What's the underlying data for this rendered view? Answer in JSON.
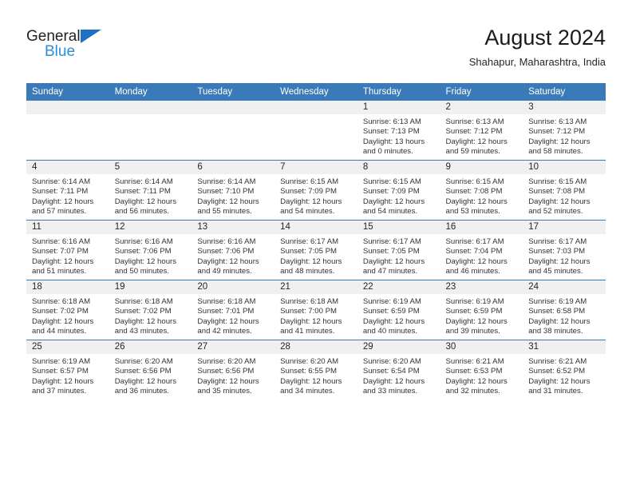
{
  "brand": {
    "name_line1": "General",
    "name_line2": "Blue",
    "logo_icon": "triangle-logo",
    "color_dark": "#231f20",
    "color_blue": "#2a8fd6"
  },
  "header": {
    "title": "August 2024",
    "location": "Shahapur, Maharashtra, India"
  },
  "calendar": {
    "accent_color": "#3b7ab8",
    "daynum_band_color": "#f0f0f0",
    "weekday_headers": [
      "Sunday",
      "Monday",
      "Tuesday",
      "Wednesday",
      "Thursday",
      "Friday",
      "Saturday"
    ],
    "weeks": [
      [
        {
          "day": "",
          "empty": true
        },
        {
          "day": "",
          "empty": true
        },
        {
          "day": "",
          "empty": true
        },
        {
          "day": "",
          "empty": true
        },
        {
          "day": "1",
          "sunrise": "Sunrise: 6:13 AM",
          "sunset": "Sunset: 7:13 PM",
          "daylight": "Daylight: 13 hours and 0 minutes."
        },
        {
          "day": "2",
          "sunrise": "Sunrise: 6:13 AM",
          "sunset": "Sunset: 7:12 PM",
          "daylight": "Daylight: 12 hours and 59 minutes."
        },
        {
          "day": "3",
          "sunrise": "Sunrise: 6:13 AM",
          "sunset": "Sunset: 7:12 PM",
          "daylight": "Daylight: 12 hours and 58 minutes."
        }
      ],
      [
        {
          "day": "4",
          "sunrise": "Sunrise: 6:14 AM",
          "sunset": "Sunset: 7:11 PM",
          "daylight": "Daylight: 12 hours and 57 minutes."
        },
        {
          "day": "5",
          "sunrise": "Sunrise: 6:14 AM",
          "sunset": "Sunset: 7:11 PM",
          "daylight": "Daylight: 12 hours and 56 minutes."
        },
        {
          "day": "6",
          "sunrise": "Sunrise: 6:14 AM",
          "sunset": "Sunset: 7:10 PM",
          "daylight": "Daylight: 12 hours and 55 minutes."
        },
        {
          "day": "7",
          "sunrise": "Sunrise: 6:15 AM",
          "sunset": "Sunset: 7:09 PM",
          "daylight": "Daylight: 12 hours and 54 minutes."
        },
        {
          "day": "8",
          "sunrise": "Sunrise: 6:15 AM",
          "sunset": "Sunset: 7:09 PM",
          "daylight": "Daylight: 12 hours and 54 minutes."
        },
        {
          "day": "9",
          "sunrise": "Sunrise: 6:15 AM",
          "sunset": "Sunset: 7:08 PM",
          "daylight": "Daylight: 12 hours and 53 minutes."
        },
        {
          "day": "10",
          "sunrise": "Sunrise: 6:15 AM",
          "sunset": "Sunset: 7:08 PM",
          "daylight": "Daylight: 12 hours and 52 minutes."
        }
      ],
      [
        {
          "day": "11",
          "sunrise": "Sunrise: 6:16 AM",
          "sunset": "Sunset: 7:07 PM",
          "daylight": "Daylight: 12 hours and 51 minutes."
        },
        {
          "day": "12",
          "sunrise": "Sunrise: 6:16 AM",
          "sunset": "Sunset: 7:06 PM",
          "daylight": "Daylight: 12 hours and 50 minutes."
        },
        {
          "day": "13",
          "sunrise": "Sunrise: 6:16 AM",
          "sunset": "Sunset: 7:06 PM",
          "daylight": "Daylight: 12 hours and 49 minutes."
        },
        {
          "day": "14",
          "sunrise": "Sunrise: 6:17 AM",
          "sunset": "Sunset: 7:05 PM",
          "daylight": "Daylight: 12 hours and 48 minutes."
        },
        {
          "day": "15",
          "sunrise": "Sunrise: 6:17 AM",
          "sunset": "Sunset: 7:05 PM",
          "daylight": "Daylight: 12 hours and 47 minutes."
        },
        {
          "day": "16",
          "sunrise": "Sunrise: 6:17 AM",
          "sunset": "Sunset: 7:04 PM",
          "daylight": "Daylight: 12 hours and 46 minutes."
        },
        {
          "day": "17",
          "sunrise": "Sunrise: 6:17 AM",
          "sunset": "Sunset: 7:03 PM",
          "daylight": "Daylight: 12 hours and 45 minutes."
        }
      ],
      [
        {
          "day": "18",
          "sunrise": "Sunrise: 6:18 AM",
          "sunset": "Sunset: 7:02 PM",
          "daylight": "Daylight: 12 hours and 44 minutes."
        },
        {
          "day": "19",
          "sunrise": "Sunrise: 6:18 AM",
          "sunset": "Sunset: 7:02 PM",
          "daylight": "Daylight: 12 hours and 43 minutes."
        },
        {
          "day": "20",
          "sunrise": "Sunrise: 6:18 AM",
          "sunset": "Sunset: 7:01 PM",
          "daylight": "Daylight: 12 hours and 42 minutes."
        },
        {
          "day": "21",
          "sunrise": "Sunrise: 6:18 AM",
          "sunset": "Sunset: 7:00 PM",
          "daylight": "Daylight: 12 hours and 41 minutes."
        },
        {
          "day": "22",
          "sunrise": "Sunrise: 6:19 AM",
          "sunset": "Sunset: 6:59 PM",
          "daylight": "Daylight: 12 hours and 40 minutes."
        },
        {
          "day": "23",
          "sunrise": "Sunrise: 6:19 AM",
          "sunset": "Sunset: 6:59 PM",
          "daylight": "Daylight: 12 hours and 39 minutes."
        },
        {
          "day": "24",
          "sunrise": "Sunrise: 6:19 AM",
          "sunset": "Sunset: 6:58 PM",
          "daylight": "Daylight: 12 hours and 38 minutes."
        }
      ],
      [
        {
          "day": "25",
          "sunrise": "Sunrise: 6:19 AM",
          "sunset": "Sunset: 6:57 PM",
          "daylight": "Daylight: 12 hours and 37 minutes."
        },
        {
          "day": "26",
          "sunrise": "Sunrise: 6:20 AM",
          "sunset": "Sunset: 6:56 PM",
          "daylight": "Daylight: 12 hours and 36 minutes."
        },
        {
          "day": "27",
          "sunrise": "Sunrise: 6:20 AM",
          "sunset": "Sunset: 6:56 PM",
          "daylight": "Daylight: 12 hours and 35 minutes."
        },
        {
          "day": "28",
          "sunrise": "Sunrise: 6:20 AM",
          "sunset": "Sunset: 6:55 PM",
          "daylight": "Daylight: 12 hours and 34 minutes."
        },
        {
          "day": "29",
          "sunrise": "Sunrise: 6:20 AM",
          "sunset": "Sunset: 6:54 PM",
          "daylight": "Daylight: 12 hours and 33 minutes."
        },
        {
          "day": "30",
          "sunrise": "Sunrise: 6:21 AM",
          "sunset": "Sunset: 6:53 PM",
          "daylight": "Daylight: 12 hours and 32 minutes."
        },
        {
          "day": "31",
          "sunrise": "Sunrise: 6:21 AM",
          "sunset": "Sunset: 6:52 PM",
          "daylight": "Daylight: 12 hours and 31 minutes."
        }
      ]
    ]
  }
}
